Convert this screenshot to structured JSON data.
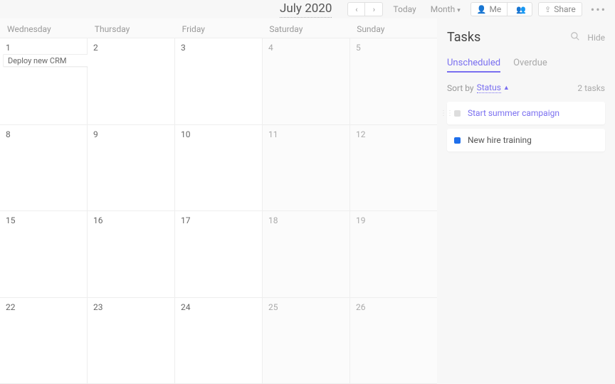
{
  "header": {
    "title": "July 2020",
    "today": "Today",
    "view": "Month",
    "me": "Me",
    "share": "Share"
  },
  "calendar": {
    "days": [
      "Wednesday",
      "Thursday",
      "Friday",
      "Saturday",
      "Sunday"
    ],
    "weekendIdx": [
      3,
      4
    ],
    "rows": [
      {
        "nums": [
          "1",
          "2",
          "3",
          "4",
          "5"
        ],
        "events": [
          {
            "label": "Deploy new CRM",
            "startCol": 0,
            "span": 2
          }
        ]
      },
      {
        "nums": [
          "8",
          "9",
          "10",
          "11",
          "12"
        ],
        "events": []
      },
      {
        "nums": [
          "15",
          "16",
          "17",
          "18",
          "19"
        ],
        "events": []
      },
      {
        "nums": [
          "22",
          "23",
          "24",
          "25",
          "26"
        ],
        "events": []
      }
    ]
  },
  "tasks": {
    "title": "Tasks",
    "hide": "Hide",
    "tabs": {
      "unscheduled": "Unscheduled",
      "overdue": "Overdue"
    },
    "sortLabel": "Sort by",
    "sortValue": "Status",
    "countNum": "2",
    "countLabel": "tasks",
    "items": [
      {
        "label": "Start summer campaign",
        "colorClass": "check-gray",
        "textClass": "purple",
        "draggable": true
      },
      {
        "label": "New hire training",
        "colorClass": "check-blue",
        "textClass": "dark",
        "draggable": false
      }
    ]
  }
}
